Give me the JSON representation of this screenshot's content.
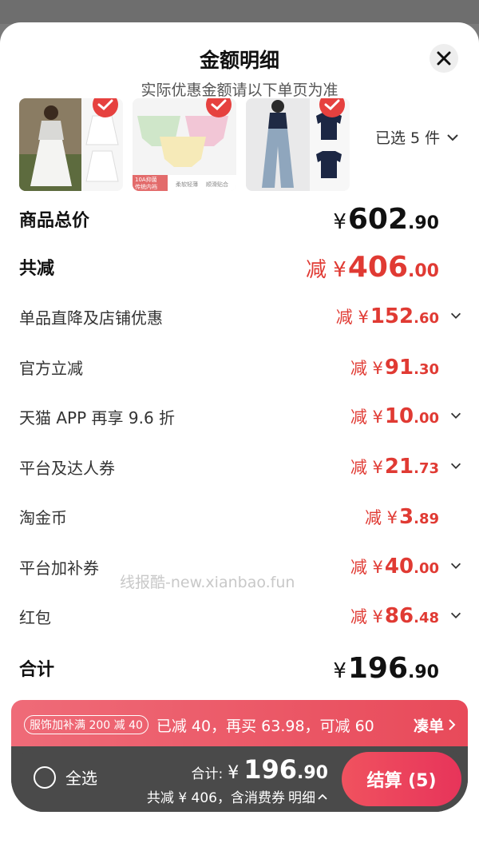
{
  "header": {
    "title": "金额明细",
    "subtitle": "实际优惠金额请以下单页为准"
  },
  "thumb_labels": {
    "t2_a": "10A抑菌",
    "t2_b": "传统内裆",
    "t2_c": "柔软轻薄",
    "t2_d": "顺滑贴合"
  },
  "selected_count": "已选 5 件",
  "rows": [
    {
      "label": "商品总价",
      "pre": "¥",
      "int": "602",
      "dec": ".90"
    },
    {
      "label": "共减",
      "pre": "减 ¥",
      "int": "406",
      "dec": ".00"
    },
    {
      "label": "单品直降及店铺优惠",
      "pre": "减 ¥",
      "int": "152",
      "dec": ".60"
    },
    {
      "label": "官方立减",
      "pre": "减 ¥",
      "int": "91",
      "dec": ".30"
    },
    {
      "label": "天猫 APP 再享 9.6 折",
      "pre": "减 ¥",
      "int": "10",
      "dec": ".00"
    },
    {
      "label": "平台及达人券",
      "pre": "减 ¥",
      "int": "21",
      "dec": ".73"
    },
    {
      "label": "淘金币",
      "pre": "减 ¥",
      "int": "3",
      "dec": ".89"
    },
    {
      "label": "平台加补券",
      "pre": "减 ¥",
      "int": "40",
      "dec": ".00"
    },
    {
      "label": "红包",
      "pre": "减 ¥",
      "int": "86",
      "dec": ".48"
    },
    {
      "label": "合计",
      "pre": "¥",
      "int": "196",
      "dec": ".90"
    }
  ],
  "watermark": "线报酷-new.xianbao.fun",
  "promo": {
    "tag": "服饰加补满 200 减 40",
    "message": "已减 40，再买 63.98，可减 60",
    "action": "凑单"
  },
  "bottom": {
    "select_all": "全选",
    "total_label": "合计:",
    "currency": "¥",
    "total_int": "196",
    "total_dec": ".90",
    "savings": "共减 ¥ 406，含消费券",
    "details": "明细",
    "checkout": "结算 (5)"
  },
  "colors": {
    "accent_red": "#e03a33",
    "checkout": "#e7345a",
    "bar": "#4a4a4a"
  }
}
